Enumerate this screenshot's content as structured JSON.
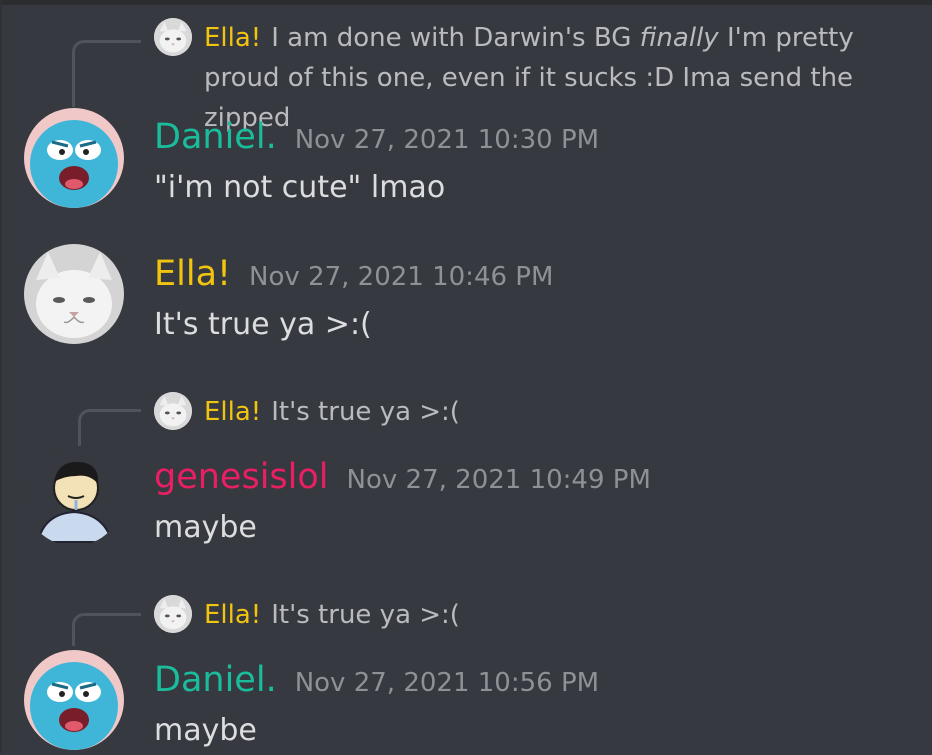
{
  "messages": [
    {
      "reply": {
        "name": "Ella!",
        "text_pre": "I am done with Darwin's BG ",
        "text_em": "finally",
        "text_post": " I'm pretty proud of this one, even if it sucks :D  Ima send the zipped"
      },
      "author": "Daniel.",
      "timestamp": "Nov 27, 2021 10:30 PM",
      "content": "\"i'm not cute\" lmao",
      "avatar_icon": "gumball-avatar-icon"
    },
    {
      "author": "Ella!",
      "timestamp": "Nov 27, 2021 10:46 PM",
      "content": "It's true ya >:(",
      "avatar_icon": "cat-avatar-icon"
    },
    {
      "reply": {
        "name": "Ella!",
        "text": "It's true ya >:("
      },
      "author": "genesislol",
      "timestamp": "Nov 27, 2021 10:49 PM",
      "content": "maybe",
      "avatar_icon": "cartoon-boy-avatar-icon"
    },
    {
      "reply": {
        "name": "Ella!",
        "text": "It's true ya >:("
      },
      "author": "Daniel.",
      "timestamp": "Nov 27, 2021 10:56 PM",
      "content": "maybe",
      "avatar_icon": "gumball-avatar-icon"
    }
  ],
  "colors": {
    "background": "#36393f",
    "daniel": "#1abc9c",
    "ella": "#f1c40f",
    "genesislol": "#e91e63",
    "timestamp": "#8e9297",
    "reply_text": "#b9bbbe"
  }
}
